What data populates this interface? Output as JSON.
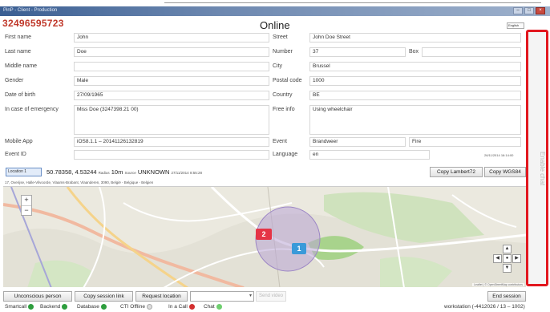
{
  "window": {
    "title": "PinP - Client - Production",
    "controls": [
      "–",
      "□",
      "×"
    ]
  },
  "header": {
    "phone_number": "32496595723",
    "status": "Online",
    "language_selector": "English"
  },
  "form": {
    "left": [
      {
        "label": "First name",
        "value": "John"
      },
      {
        "label": "Last name",
        "value": "Doe"
      },
      {
        "label": "Middle name",
        "value": ""
      },
      {
        "label": "Gender",
        "value": "Male"
      },
      {
        "label": "Date of birth",
        "value": "27/09/1965"
      },
      {
        "label": "In case of emergency",
        "value": "Miss Doe (3247398.21 00)"
      },
      {
        "label": "Mobile App",
        "value": "iOS8.1.1 – 20141126132819"
      },
      {
        "label": "Event ID",
        "value": ""
      }
    ],
    "right": [
      {
        "label": "Street",
        "value": "John Doe Street"
      },
      {
        "label": "Number",
        "value": "37"
      },
      {
        "label": "City",
        "value": "Brussel"
      },
      {
        "label": "Postal code",
        "value": "1000"
      },
      {
        "label": "Country",
        "value": "BE"
      },
      {
        "label": "Free info",
        "value": "Using wheelchair"
      },
      {
        "label": "Event",
        "value": "Brandweer"
      },
      {
        "label": "Language",
        "value": "en"
      }
    ],
    "box_label": "Box",
    "box_value": "",
    "event_extra": "Fire",
    "timestamp": "26/11/2014 16:14:00"
  },
  "side_panel": {
    "enable_chat": "Enable chat"
  },
  "location": {
    "selector": "Location 1",
    "coordinates": "50.78358, 4.53244",
    "radius_label": "Radius",
    "radius_value": "10m",
    "source_label": "Source",
    "source_value": "UNKNOWN",
    "time": "27/11/2014 8:55:28",
    "copy_lambert": "Copy Lambert72",
    "copy_wgs": "Copy WGS84",
    "address": "17, Overijse, Halle-Vilvoorde, Vlaams-Brabant, Vlaanderen, 3090, België - Belgique - Belgien"
  },
  "map": {
    "zoom_in": "+",
    "zoom_out": "−",
    "marker_2": "2",
    "marker_1": "1",
    "marker_2_color": "#e53446",
    "marker_1_color": "#3a9ad9",
    "attribution": "Leaflet | © OpenStreetMap contributors",
    "nav_center": "●"
  },
  "actions": {
    "unconscious": "Unconscious person",
    "copy_session": "Copy session link",
    "request_location": "Request location",
    "send_video": "Send video",
    "end_session": "End session"
  },
  "statusbar": {
    "items": [
      {
        "label": "Smartcall",
        "color": "#2e9e3e"
      },
      {
        "label": "Backend",
        "color": "#2e9e3e"
      },
      {
        "label": "Database",
        "color": "#2e9e3e"
      },
      {
        "label": "CTI Offline",
        "color": "#dddddd"
      },
      {
        "label": "In a Call",
        "color": "#d32f2f"
      },
      {
        "label": "Chat",
        "color": "#6fcf6f"
      }
    ],
    "workstation": "workstation (-4412026 / 13 – 1002)"
  }
}
